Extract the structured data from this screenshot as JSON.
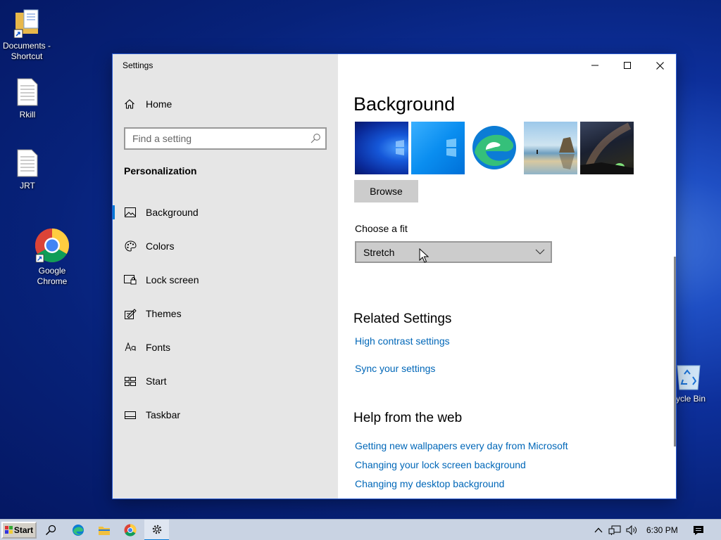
{
  "desktop": {
    "icons": [
      {
        "label": "Documents - Shortcut",
        "icon": "folder-shortcut-icon"
      },
      {
        "label": "Rkill",
        "icon": "text-file-icon"
      },
      {
        "label": "JRT",
        "icon": "text-file-icon"
      },
      {
        "label": "Google Chrome",
        "icon": "chrome-icon"
      },
      {
        "label": "cycle Bin",
        "icon": "recycle-bin-icon"
      }
    ]
  },
  "window": {
    "title": "Settings",
    "controls": {
      "minimize": "minimize-icon",
      "maximize": "maximize-icon",
      "close": "close-icon"
    }
  },
  "sidebar": {
    "home_label": "Home",
    "search_placeholder": "Find a setting",
    "section_title": "Personalization",
    "items": [
      {
        "label": "Background",
        "icon": "picture-icon",
        "active": true
      },
      {
        "label": "Colors",
        "icon": "palette-icon",
        "active": false
      },
      {
        "label": "Lock screen",
        "icon": "lock-screen-icon",
        "active": false
      },
      {
        "label": "Themes",
        "icon": "themes-icon",
        "active": false
      },
      {
        "label": "Fonts",
        "icon": "fonts-icon",
        "active": false
      },
      {
        "label": "Start",
        "icon": "start-icon",
        "active": false
      },
      {
        "label": "Taskbar",
        "icon": "taskbar-icon",
        "active": false
      }
    ]
  },
  "main": {
    "title": "Background",
    "browse_label": "Browse",
    "fit_label": "Choose a fit",
    "fit_value": "Stretch",
    "related_title": "Related Settings",
    "related_links": [
      "High contrast settings",
      "Sync your settings"
    ],
    "help_title": "Help from the web",
    "help_links": [
      "Getting new wallpapers every day from Microsoft",
      "Changing your lock screen background",
      "Changing my desktop background"
    ]
  },
  "taskbar": {
    "start_label": "Start",
    "clock": "6:30 PM",
    "colors": {
      "accent": "#0078d7",
      "link": "#0067b8"
    }
  }
}
